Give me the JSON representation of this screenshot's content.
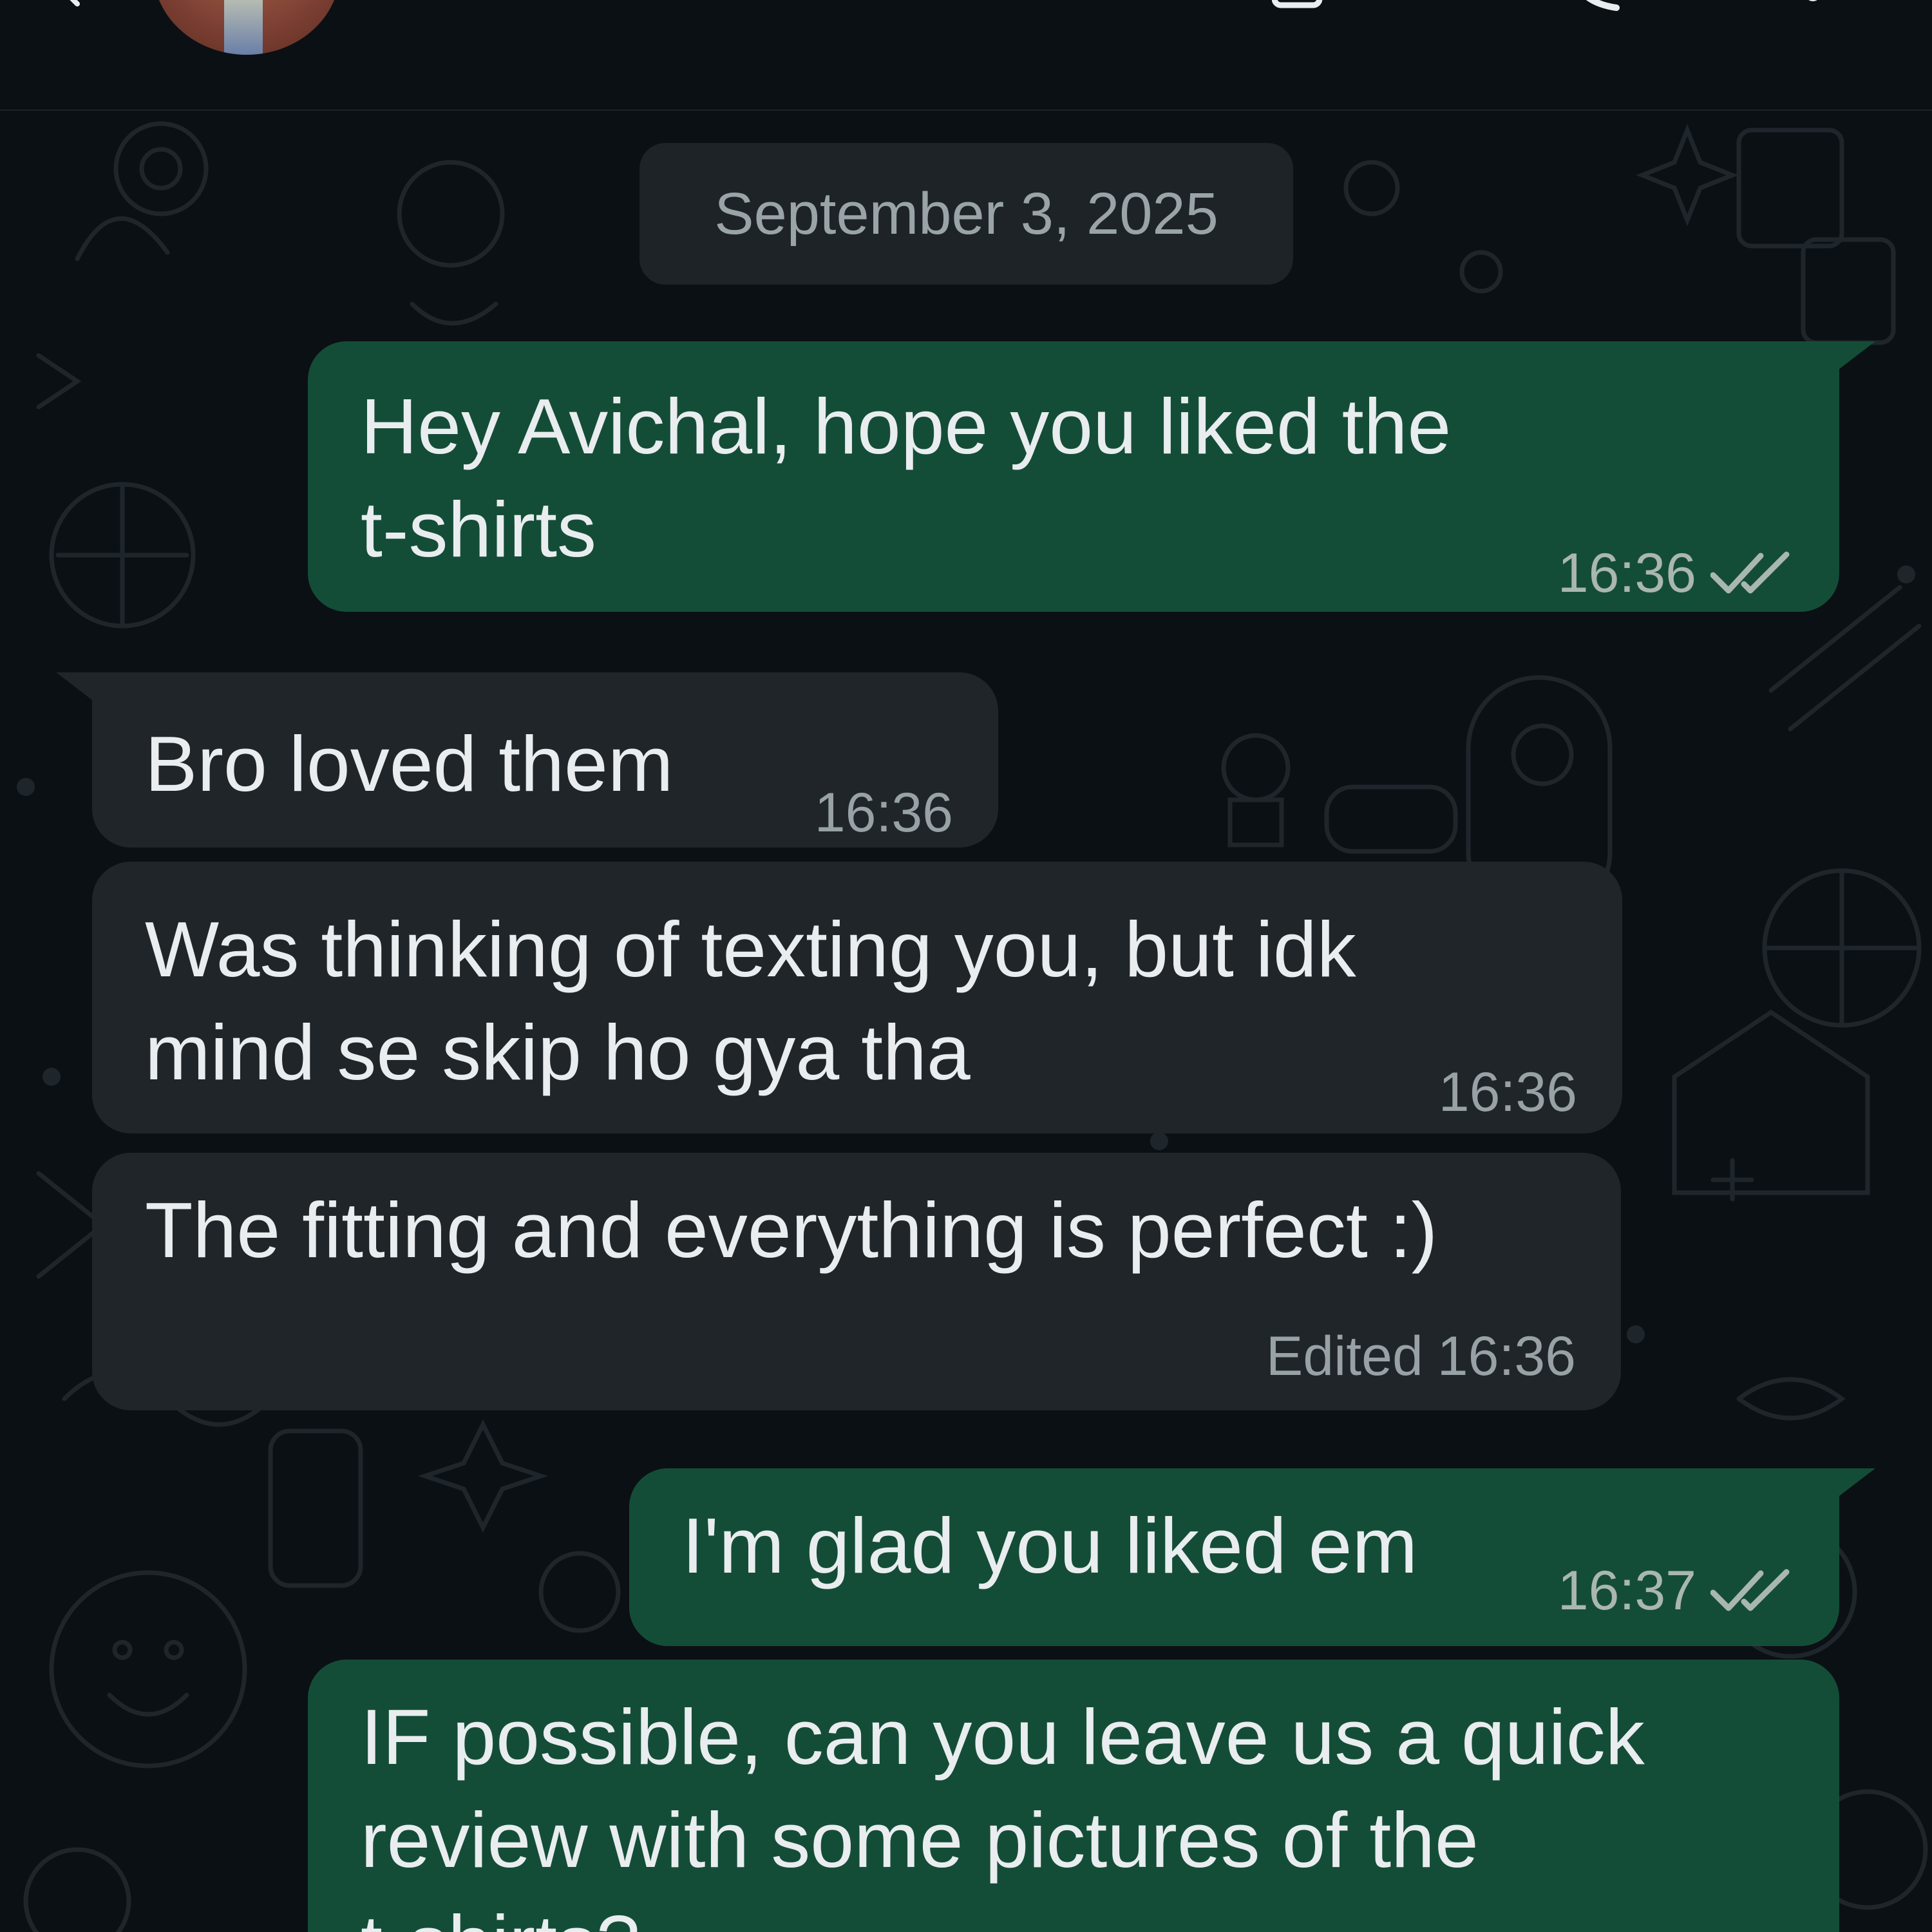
{
  "header": {
    "back_icon": "arrow-left-icon",
    "video_icon": "video-camera-icon",
    "call_icon": "phone-icon",
    "menu_icon": "more-vertical-icon"
  },
  "chat": {
    "date_divider": "September 3, 2025",
    "messages": [
      {
        "direction": "outgoing",
        "text": "Hey Avichal, hope you liked the\nt-shirts",
        "time": "16:36",
        "status": "read"
      },
      {
        "direction": "incoming",
        "text": "Bro loved them",
        "time": "16:36"
      },
      {
        "direction": "incoming",
        "text": "Was thinking of texting you, but idk\nmind se skip ho gya tha",
        "time": "16:36"
      },
      {
        "direction": "incoming",
        "text": "The fitting and everything is perfect :)",
        "edited_label": "Edited",
        "time": "16:36"
      },
      {
        "direction": "outgoing",
        "text": "I'm glad you liked em",
        "time": "16:37",
        "status": "read"
      },
      {
        "direction": "outgoing",
        "text": "IF possible, can you leave us a quick\nreview with some pictures of the\nt-shirts?"
      }
    ]
  },
  "colors": {
    "background": "#0b1014",
    "outgoing_bubble": "#144d37",
    "incoming_bubble": "#1f2529",
    "text": "#e9edef",
    "meta_text": "#a9b7b0",
    "tick_color": "#a9b7b0"
  }
}
